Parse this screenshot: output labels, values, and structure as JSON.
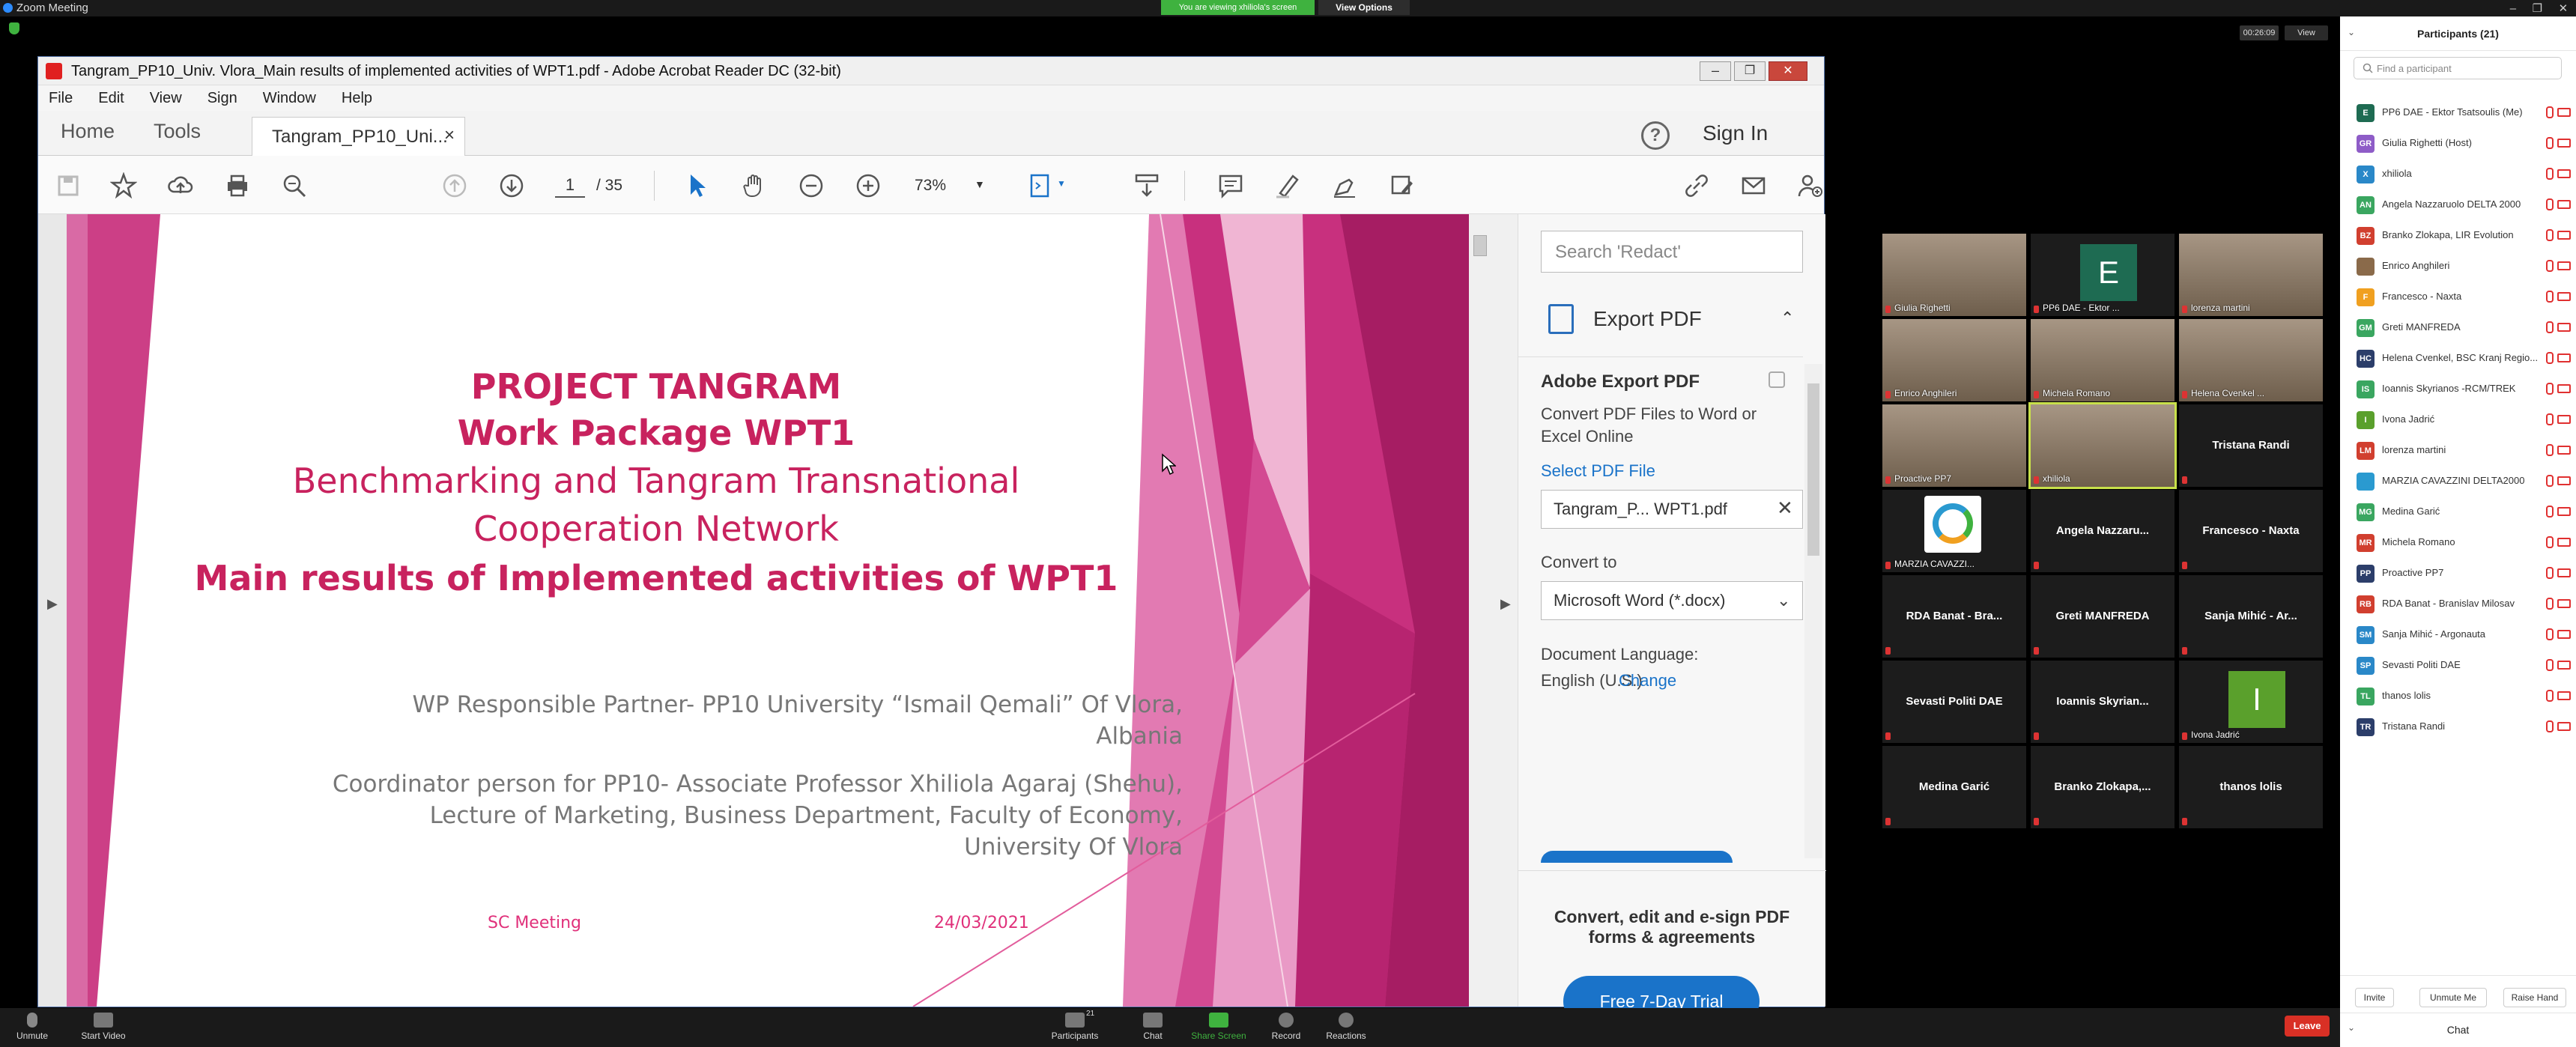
{
  "app": {
    "title": "Zoom Meeting",
    "viewing_banner": "You are viewing xhiliola's screen",
    "view_options": "View Options"
  },
  "share_bar": {
    "timer": "00:26:09",
    "view_label": "View"
  },
  "acrobat": {
    "window_title": "Tangram_PP10_Univ. Vlora_Main results of implemented activities of WPT1.pdf - Adobe Acrobat Reader DC (32-bit)",
    "menu": [
      "File",
      "Edit",
      "View",
      "Sign",
      "Window",
      "Help"
    ],
    "tabs": {
      "home": "Home",
      "tools": "Tools",
      "doc": "Tangram_PP10_Uni...",
      "close": "×"
    },
    "help": "?",
    "sign_in": "Sign In",
    "page_current": "1",
    "page_total": "/ 35",
    "zoom": "73%"
  },
  "slide": {
    "title1": "PROJECT TANGRAM",
    "title2": "Work Package WPT1",
    "title3": "Benchmarking and Tangram Transnational",
    "title4": "Cooperation Network",
    "title5": "Main results of Implemented activities of WPT1",
    "resp1": "WP Responsible Partner- PP10 University “Ismail Qemali” Of Vlora,",
    "resp2": "Albania",
    "coord1": "Coordinator  person for PP10- Associate Professor Xhiliola Agaraj (Shehu),",
    "coord2": "Lecture of Marketing, Business Department, Faculty of Economy,",
    "coord3": "University Of Vlora",
    "meeting": "SC Meeting",
    "date": "24/03/2021"
  },
  "right_pane": {
    "search_placeholder": "Search 'Redact'",
    "export_label": "Export PDF",
    "ae_title": "Adobe Export PDF",
    "ae_desc": "Convert PDF Files to Word or Excel Online",
    "select_file": "Select PDF File",
    "file_name": "Tangram_P... WPT1.pdf",
    "convert_to": "Convert to",
    "format": "Microsoft Word (*.docx)",
    "doc_lang_label": "Document Language:",
    "doc_lang": "English (U.S.)",
    "change": "Change",
    "promo": "Convert, edit and e-sign PDF forms & agreements",
    "trial": "Free 7-Day Trial"
  },
  "videos": [
    {
      "name": "Giulia Righetti",
      "kind": "person"
    },
    {
      "name": "PP6 DAE - Ektor ...",
      "kind": "avatar",
      "letter": "E",
      "color": "#1e6b52"
    },
    {
      "name": "lorenza martini",
      "kind": "person"
    },
    {
      "name": "Enrico Anghileri",
      "kind": "person"
    },
    {
      "name": "Michela Romano",
      "kind": "person"
    },
    {
      "name": "Helena Cvenkel ...",
      "kind": "person"
    },
    {
      "name": "Proactive PP7",
      "kind": "person"
    },
    {
      "name": "xhiliola",
      "kind": "person",
      "active": true
    },
    {
      "name": "Tristana Randi",
      "kind": "text"
    },
    {
      "name": "MARZIA CAVAZZI...",
      "kind": "logo"
    },
    {
      "name": "Angela  Nazzaru...",
      "kind": "text"
    },
    {
      "name": "Francesco - Naxta",
      "kind": "text"
    },
    {
      "name": "RDA Banat - Bra...",
      "kind": "text"
    },
    {
      "name": "Greti MANFREDA",
      "kind": "text"
    },
    {
      "name": "Sanja Mihić - Ar...",
      "kind": "text"
    },
    {
      "name": "Sevasti Politi DAE",
      "kind": "text"
    },
    {
      "name": "Ioannis  Skyrian...",
      "kind": "text"
    },
    {
      "name": "Ivona Jadrić",
      "kind": "avatar",
      "letter": "I",
      "color": "#5aa02c"
    },
    {
      "name": "Medina Garić",
      "kind": "text"
    },
    {
      "name": "Branko  Zlokapa,...",
      "kind": "text"
    },
    {
      "name": "thanos lolis",
      "kind": "text"
    }
  ],
  "participants": {
    "title": "Participants (21)",
    "search_placeholder": "Find a participant",
    "list": [
      {
        "initials": "E",
        "color": "#1e6b52",
        "name": "PP6 DAE - Ektor Tsatsoulis (Me)"
      },
      {
        "initials": "GR",
        "color": "#8e5cc7",
        "name": "Giulia Righetti (Host)"
      },
      {
        "initials": "X",
        "color": "#2a88c8",
        "name": "xhiliola"
      },
      {
        "initials": "AN",
        "color": "#3aa660",
        "name": "Angela Nazzaruolo DELTA 2000"
      },
      {
        "initials": "BZ",
        "color": "#d13f2f",
        "name": "Branko Zlokapa, LIR Evolution"
      },
      {
        "initials": "",
        "color": "#8a6a4a",
        "name": "Enrico Anghileri"
      },
      {
        "initials": "F",
        "color": "#f0a020",
        "name": "Francesco - Naxta"
      },
      {
        "initials": "GM",
        "color": "#3aa660",
        "name": "Greti MANFREDA"
      },
      {
        "initials": "HC",
        "color": "#2c3e6a",
        "name": "Helena Cvenkel, BSC Kranj Regio..."
      },
      {
        "initials": "IS",
        "color": "#3aa660",
        "name": "Ioannis Skyrianos -RCM/TREK"
      },
      {
        "initials": "I",
        "color": "#5aa02c",
        "name": "Ivona Jadrić"
      },
      {
        "initials": "LM",
        "color": "#d13f2f",
        "name": "lorenza martini"
      },
      {
        "initials": "",
        "color": "#2a9ad0",
        "name": "MARZIA CAVAZZINI DELTA2000"
      },
      {
        "initials": "MG",
        "color": "#3aa660",
        "name": "Medina Garić"
      },
      {
        "initials": "MR",
        "color": "#d13f2f",
        "name": "Michela Romano"
      },
      {
        "initials": "PP",
        "color": "#2c3e6a",
        "name": "Proactive PP7"
      },
      {
        "initials": "RB",
        "color": "#d13f2f",
        "name": "RDA Banat - Branislav Milosav"
      },
      {
        "initials": "SM",
        "color": "#2a88c8",
        "name": "Sanja Mihić - Argonauta"
      },
      {
        "initials": "SP",
        "color": "#2a88c8",
        "name": "Sevasti Politi DAE"
      },
      {
        "initials": "TL",
        "color": "#3aa660",
        "name": "thanos lolis"
      },
      {
        "initials": "TR",
        "color": "#2c3e6a",
        "name": "Tristana Randi"
      }
    ],
    "invite": "Invite",
    "unmute_me": "Unmute Me",
    "raise_hand": "Raise Hand",
    "chat": "Chat"
  },
  "bottom": {
    "unmute": "Unmute",
    "start_video": "Start Video",
    "participants": "Participants",
    "participants_count": "21",
    "chat": "Chat",
    "share": "Share Screen",
    "record": "Record",
    "reactions": "Reactions",
    "leave": "Leave"
  }
}
